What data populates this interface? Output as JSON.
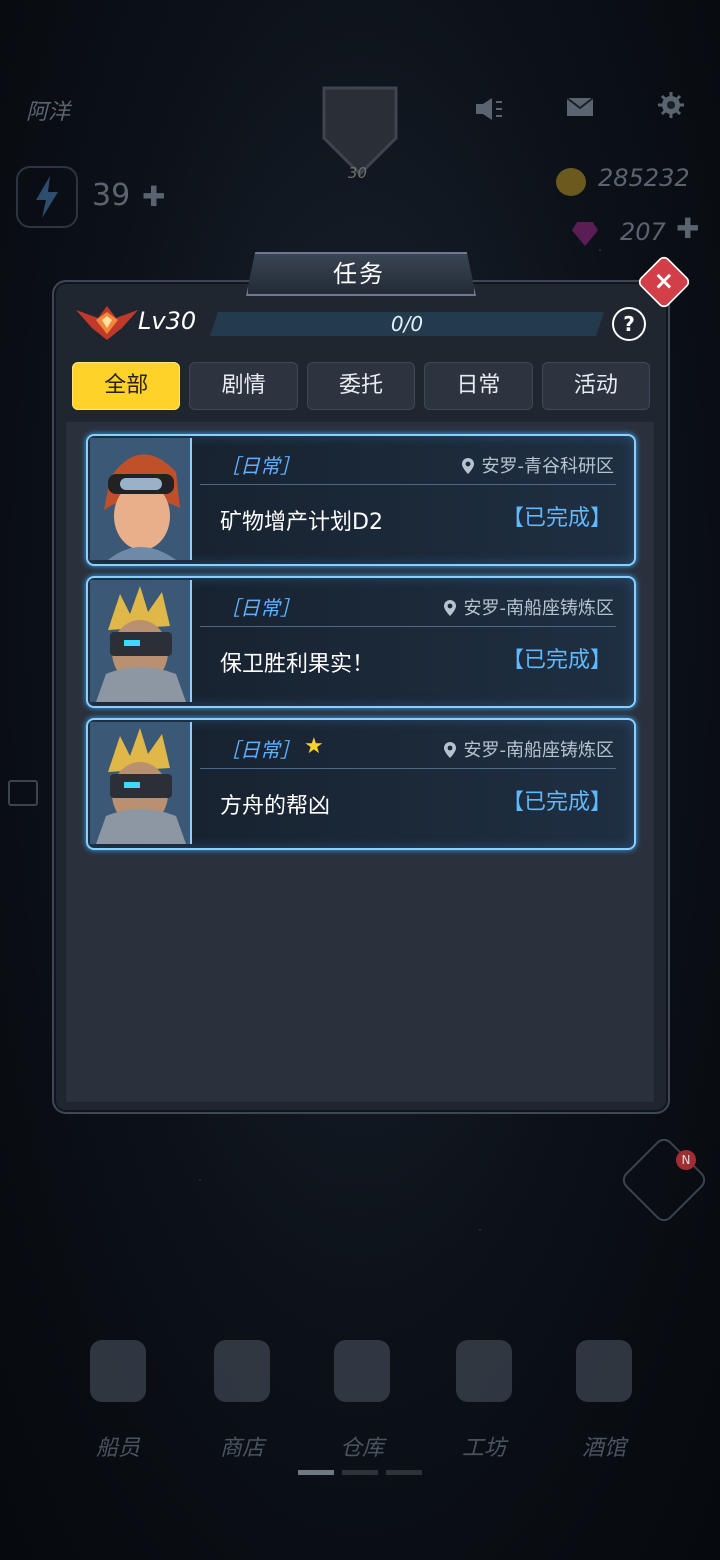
{
  "hud": {
    "player_name": "阿洋",
    "avatar_level": "30",
    "energy": "39",
    "coins": "285232",
    "gems": "207"
  },
  "modal": {
    "title": "任务",
    "level": "Lv30",
    "progress_text": "0/0",
    "progress_fraction": 0,
    "help_label": "?",
    "close_label": "×"
  },
  "tabs": [
    {
      "label": "全部",
      "active": true
    },
    {
      "label": "剧情",
      "active": false
    },
    {
      "label": "委托",
      "active": false
    },
    {
      "label": "日常",
      "active": false
    },
    {
      "label": "活动",
      "active": false
    }
  ],
  "tasks": [
    {
      "type": "［日常］",
      "starred": false,
      "location": "安罗-青谷科研区",
      "name": "矿物增产计划D2",
      "status": "【已完成】",
      "portrait": "female-goggles-icon"
    },
    {
      "type": "［日常］",
      "starred": false,
      "location": "安罗-南船座铸炼区",
      "name": "保卫胜利果实！",
      "status": "【已完成】",
      "portrait": "visor-soldier-icon"
    },
    {
      "type": "［日常］",
      "starred": true,
      "location": "安罗-南船座铸炼区",
      "name": "方舟的帮凶",
      "status": "【已完成】",
      "portrait": "visor-soldier-icon"
    }
  ],
  "nav": [
    {
      "label": "船员",
      "icon": "crew-icon"
    },
    {
      "label": "商店",
      "icon": "shop-icon"
    },
    {
      "label": "仓库",
      "icon": "warehouse-icon"
    },
    {
      "label": "工坊",
      "icon": "workshop-icon"
    },
    {
      "label": "酒馆",
      "icon": "tavern-icon"
    }
  ],
  "side_badge": "N",
  "colors": {
    "accent_yellow": "#ffd22a",
    "close_red": "#d33f48",
    "status_blue": "#5fb9ff",
    "progress_blue": "#2680c4"
  }
}
